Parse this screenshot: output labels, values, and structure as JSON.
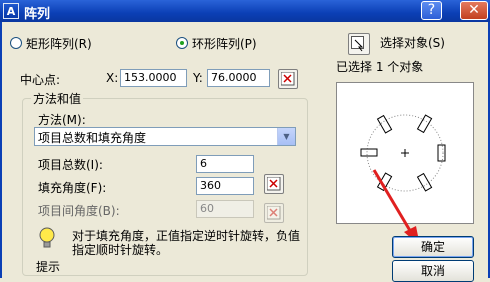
{
  "window": {
    "title": "阵列",
    "app_icon_text": "A"
  },
  "mode": {
    "rect_label": "矩形阵列(R)",
    "polar_label": "环形阵列(P)",
    "selected": "polar"
  },
  "select_objects": {
    "label": "选择对象(S)",
    "status": "已选择 1 个对象"
  },
  "center": {
    "label": "中心点:",
    "x_label": "X:",
    "x_value": "153.0000",
    "y_label": "Y:",
    "y_value": "76.0000"
  },
  "method_group": {
    "title": "方法和值",
    "method_label": "方法(M):",
    "method_value": "项目总数和填充角度",
    "total_label": "项目总数(I):",
    "total_value": "6",
    "fill_label": "填充角度(F):",
    "fill_value": "360",
    "between_label": "项目间角度(B):",
    "between_value": "60"
  },
  "tip": {
    "text": "对于填充角度，正值指定逆时针旋转，负值指定顺时针旋转。",
    "label": "提示"
  },
  "buttons": {
    "ok": "确定",
    "cancel": "取消"
  },
  "colors": {
    "title_bar": "#0b3fb5",
    "arrow": "#e02020",
    "dialog_bg": "#ece9d8"
  }
}
